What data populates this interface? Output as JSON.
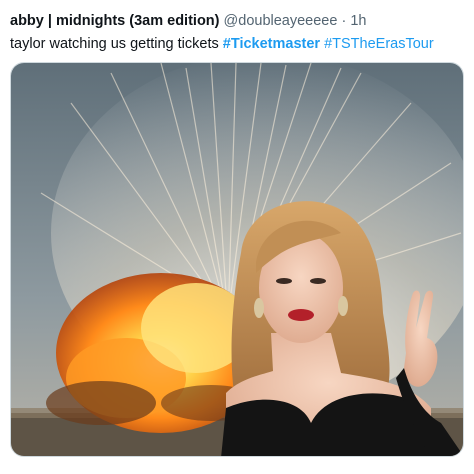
{
  "tweet": {
    "display_name": "abby | midnights (3am edition)",
    "handle": "@doubleayeeeee",
    "separator": "·",
    "time": "1h",
    "text_prefix": "taylor watching us getting tickets ",
    "hashtags": [
      "#Ticketmaster",
      "#TSTheErasTour"
    ],
    "hashtag_separator": " "
  },
  "media": {
    "description_icon": "explosion-photo-with-person",
    "colors": {
      "sky": "#6f7f8a",
      "fire": "#ff9a1f",
      "hair": "#c9955a",
      "dress": "#141414",
      "skin": "#f0c6ae",
      "link": "#1d9bf0"
    }
  }
}
